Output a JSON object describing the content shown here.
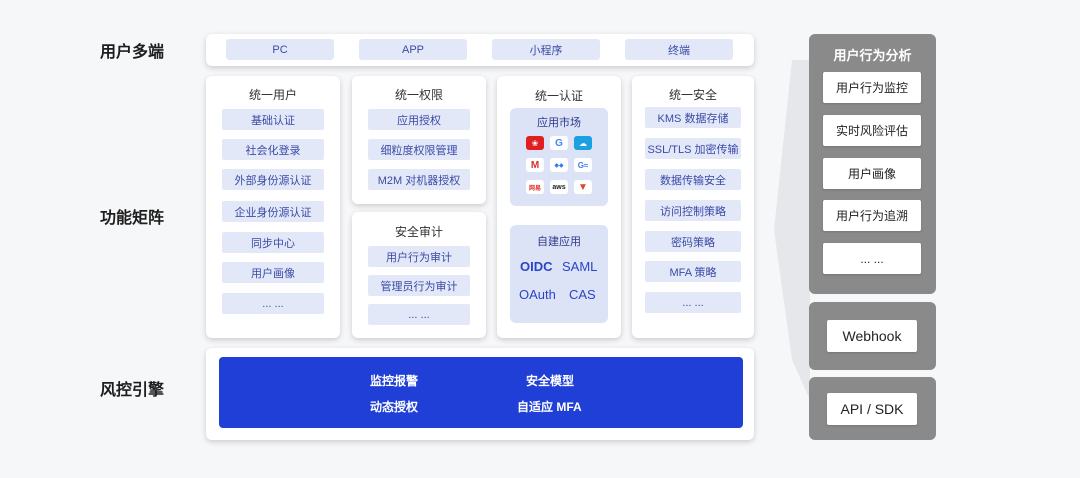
{
  "row_labels": {
    "multi_end": "用户多端",
    "matrix": "功能矩阵",
    "risk_engine": "风控引擎"
  },
  "multi_end": {
    "items": [
      "PC",
      "APP",
      "小程序",
      "终端"
    ]
  },
  "unified_user": {
    "title": "统一用户",
    "items": [
      "基础认证",
      "社会化登录",
      "外部身份源认证",
      "企业身份源认证",
      "同步中心",
      "用户画像",
      "... ..."
    ]
  },
  "unified_permission": {
    "title": "统一权限",
    "items": [
      "应用授权",
      "细粒度权限管理",
      "M2M 对机器授权"
    ]
  },
  "security_audit": {
    "title": "安全审计",
    "items": [
      "用户行为审计",
      "管理员行为审计",
      "... ..."
    ]
  },
  "unified_auth": {
    "title": "统一认证",
    "app_market": "应用市场",
    "logos": [
      "huawei-icon",
      "google-icon",
      "salesforce-icon",
      "gmail-icon",
      "dingtalk-icon",
      "feishu-icon",
      "netease-icon",
      "aws-icon",
      "gitlab-icon"
    ],
    "self_built": "自建应用",
    "protocols": [
      "OIDC",
      "SAML",
      "OAuth",
      "CAS"
    ]
  },
  "unified_security": {
    "title": "统一安全",
    "items": [
      "KMS 数据存储",
      "SSL/TLS 加密传输",
      "数据传输安全",
      "访问控制策略",
      "密码策略",
      "MFA 策略",
      "... ..."
    ]
  },
  "risk_engine": {
    "items": [
      "监控报警",
      "安全模型",
      "动态授权",
      "自适应 MFA"
    ]
  },
  "behavior_analysis": {
    "title": "用户行为分析",
    "items": [
      "用户行为监控",
      "实时风险评估",
      "用户画像",
      "用户行为追溯",
      "... ..."
    ]
  },
  "webhook": "Webhook",
  "api_sdk": "API / SDK",
  "colors": {
    "accent": "#1f3fd6",
    "tag_bg": "#e3e8f9",
    "tag_text": "#3a4aa5",
    "side_bg": "#8a8a8a"
  }
}
